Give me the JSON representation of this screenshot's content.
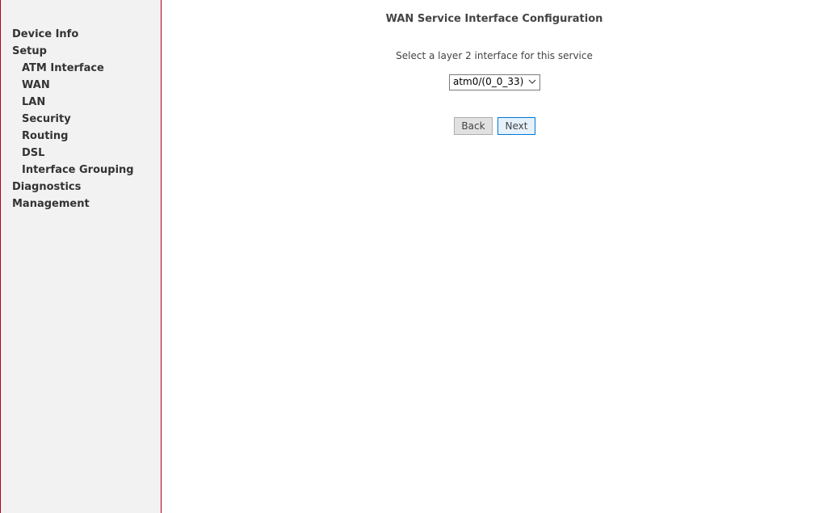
{
  "sidebar": {
    "items": [
      {
        "label": "Device Info",
        "level": 0
      },
      {
        "label": "Setup",
        "level": 0
      },
      {
        "label": "ATM Interface",
        "level": 1
      },
      {
        "label": "WAN",
        "level": 1
      },
      {
        "label": "LAN",
        "level": 1
      },
      {
        "label": "Security",
        "level": 1
      },
      {
        "label": "Routing",
        "level": 1
      },
      {
        "label": "DSL",
        "level": 1
      },
      {
        "label": "Interface Grouping",
        "level": 1
      },
      {
        "label": "Diagnostics",
        "level": 0
      },
      {
        "label": "Management",
        "level": 0
      }
    ]
  },
  "main": {
    "title": "WAN Service Interface Configuration",
    "instruction": "Select a layer 2 interface for this service",
    "interface_select": {
      "selected": "atm0/(0_0_33)"
    },
    "buttons": {
      "back_label": "Back",
      "next_label": "Next"
    }
  },
  "colors": {
    "sidebar_background": "#f2f2f2",
    "sidebar_border": "#b00020",
    "next_button_border": "#0078d7"
  }
}
